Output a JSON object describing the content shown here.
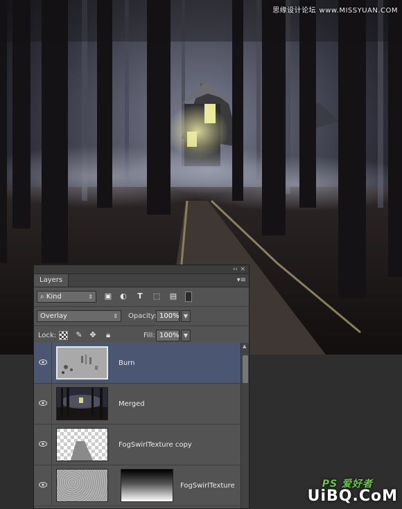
{
  "watermark_top": {
    "text": "思缘设计论坛",
    "url": "www.MISSYUAN.COM"
  },
  "panel": {
    "title_controls": {
      "collapse": "‹‹",
      "close": "×"
    },
    "tab": "Layers",
    "menu_icon": "panel-menu-icon",
    "filter": {
      "kind_label": "Kind",
      "icons": [
        "image-filter-icon",
        "adjustment-filter-icon",
        "type-filter-icon",
        "shape-filter-icon",
        "smart-object-filter-icon",
        "filter-toggle-icon"
      ]
    },
    "blend": {
      "mode": "Overlay",
      "opacity_label": "Opacity:",
      "opacity_value": "100%"
    },
    "lock": {
      "label": "Lock:",
      "icons": [
        "lock-transparent-icon",
        "lock-paint-icon",
        "lock-position-icon",
        "lock-all-icon"
      ],
      "fill_label": "Fill:",
      "fill_value": "100%"
    },
    "layers": [
      {
        "name": "Burn",
        "selected": true
      },
      {
        "name": "Merged",
        "selected": false
      },
      {
        "name": "FogSwirlTexture copy",
        "selected": false
      },
      {
        "name": "FogSwirlTexture",
        "selected": false
      }
    ]
  },
  "watermark_bottom": {
    "text": "UiBQ.CoM",
    "brand": "PS 爱好者"
  }
}
